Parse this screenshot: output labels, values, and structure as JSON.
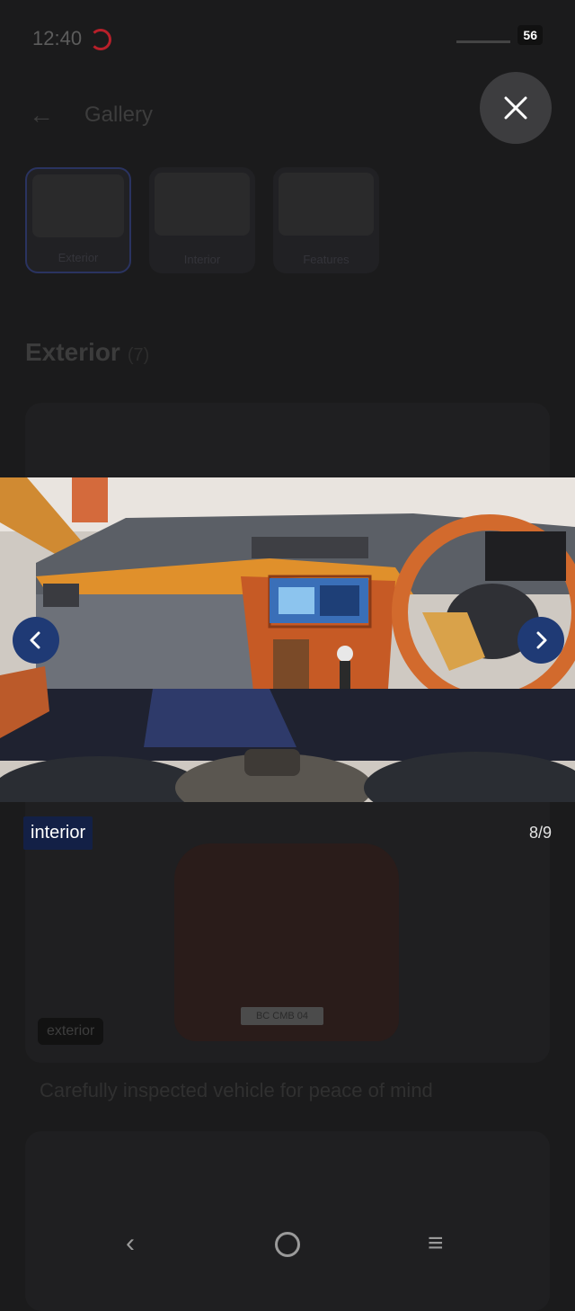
{
  "status_bar": {
    "time": "12:40",
    "battery": "56"
  },
  "gallery": {
    "title": "Gallery",
    "tabs": [
      {
        "label": "Exterior",
        "active": true
      },
      {
        "label": "Interior",
        "active": false
      },
      {
        "label": "Features",
        "active": false
      }
    ],
    "section_heading": "Exterior",
    "section_count": "(7)",
    "card_tag": "exterior",
    "card_plate": "BC CMB 04",
    "caption": "Carefully inspected vehicle for peace of mind"
  },
  "viewer": {
    "image_label": "interior",
    "counter": "8/9"
  },
  "colors": {
    "overlay_bg": "#1b1b1c",
    "label_bg": "#132046",
    "arrow_bg": "#1f3a75",
    "close_bg": "#3d3d3f"
  }
}
